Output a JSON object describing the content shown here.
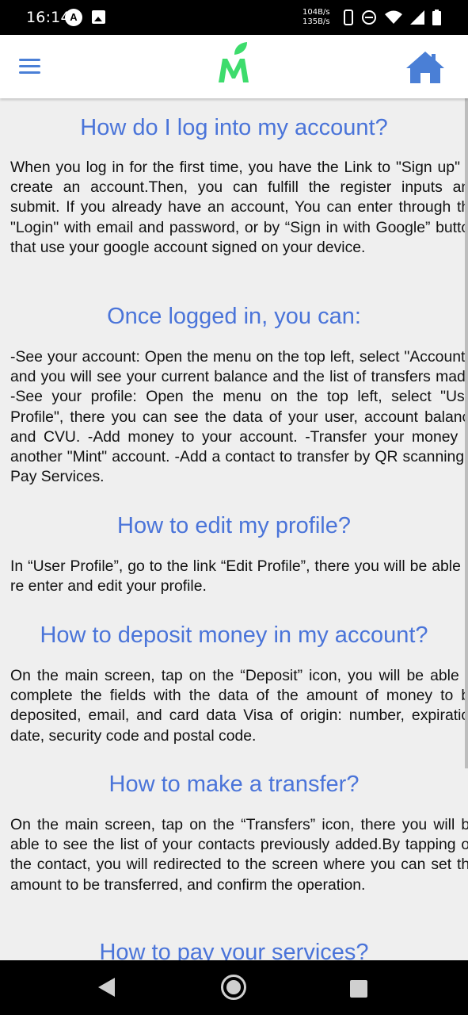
{
  "status_bar": {
    "time": "16:14",
    "a_icon_glyph": "A",
    "speed_up": "104B/s",
    "speed_down": "135B/s",
    "icons": [
      "a-circle-icon",
      "image-icon",
      "phone-icon",
      "dnd-icon",
      "wifi-icon",
      "signal-icon",
      "battery-icon"
    ]
  },
  "app_bar": {
    "logo_letter": "M",
    "logo_color": "#3ddc6c",
    "accent_color": "#4a7fd6"
  },
  "faq": [
    {
      "question": "How do I log into my account?",
      "answer": "When you log in for the first time, you have the Link to \"Sign up\" to create an account.Then, you can fulfill the register inputs and submit. If you already have an account, You can enter through the \"Login\" with email and password, or by “Sign in with Google” button that use your google account signed on your device."
    },
    {
      "question": "Once logged in, you can:",
      "answer": "-See your account: Open the menu on the top left, select \"Accounts\" and you will see your current balance and the list of transfers made. -See your profile: Open the menu on the top left, select \"User Profile\", there you can see the data of your user, account balance and CVU. -Add money to your account. -Transfer your money to another \"Mint\" account. -Add a contact to transfer by QR scanning. -Pay Services."
    },
    {
      "question": "How to edit my profile?",
      "answer": "In “User Profile”, go to the link “Edit Profile”, there you will be able to re enter and edit your profile."
    },
    {
      "question": "How to deposit money in my account?",
      "answer": "On the main screen, tap on the “Deposit” icon, you will be able to complete the fields with the data of the amount of money to be deposited, email, and card data Visa of origin: number, expiration date, security code and postal code."
    },
    {
      "question": "How to make a transfer?",
      "answer": "On the main screen, tap on the “Transfers” icon, there you will be able to see the list of your contacts previously added.By tapping on the contact, you will redirected to the screen where you can set the amount to be transferred, and confirm the operation."
    },
    {
      "question": "How to pay your services?",
      "answer": ""
    }
  ],
  "colors": {
    "heading": "#4a74d9",
    "background": "#efefef"
  }
}
